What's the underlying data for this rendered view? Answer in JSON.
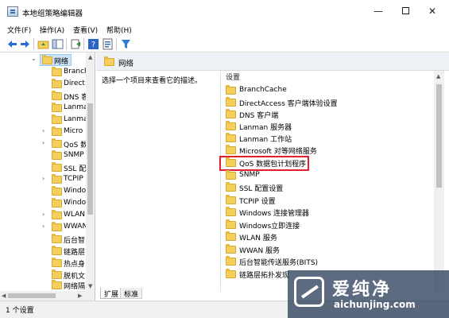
{
  "window": {
    "title": "本地组策略编辑器",
    "minimize": "—",
    "close": "✕"
  },
  "menu": [
    "文件(F)",
    "操作(A)",
    "查看(V)",
    "帮助(H)"
  ],
  "toolbar": {
    "icons": [
      "back-arrow-icon",
      "forward-arrow-icon",
      "folder-up-icon",
      "show-hide-tree-icon",
      "export-list-icon",
      "help-icon",
      "properties-icon",
      "filter-icon"
    ],
    "colors": {
      "arrow": "#2a6ad6",
      "help": "#2b63c6",
      "filter": "#2f7ad1"
    }
  },
  "tree": {
    "selected": "网络",
    "items": [
      {
        "label": "网络",
        "arrow": "⌄"
      },
      {
        "label": "Branch",
        "arrow": ""
      },
      {
        "label": "Direct",
        "arrow": ""
      },
      {
        "label": "DNS 客",
        "arrow": ""
      },
      {
        "label": "Lanma",
        "arrow": ""
      },
      {
        "label": "Lanma",
        "arrow": ""
      },
      {
        "label": "Micro",
        "arrow": "›"
      },
      {
        "label": "QoS 数",
        "arrow": "›"
      },
      {
        "label": "SNMP",
        "arrow": ""
      },
      {
        "label": "SSL 配",
        "arrow": ""
      },
      {
        "label": "TCPIP",
        "arrow": "›"
      },
      {
        "label": "Windo",
        "arrow": ""
      },
      {
        "label": "Windo",
        "arrow": ""
      },
      {
        "label": "WLAN",
        "arrow": "›"
      },
      {
        "label": "WWAN",
        "arrow": "›"
      },
      {
        "label": "后台智",
        "arrow": ""
      },
      {
        "label": "链路层",
        "arrow": ""
      },
      {
        "label": "热点身",
        "arrow": ""
      },
      {
        "label": "脱机文",
        "arrow": ""
      },
      {
        "label": "网络隔",
        "arrow": ""
      }
    ]
  },
  "main": {
    "header": "网络",
    "description": "选择一个项目来查看它的描述。",
    "column_header": "设置",
    "items": [
      "BranchCache",
      "DirectAccess 客户端体验设置",
      "DNS 客户端",
      "Lanman 服务器",
      "Lanman 工作站",
      "Microsoft 对等网络服务",
      "QoS 数据包计划程序",
      "SNMP",
      "SSL 配置设置",
      "TCPIP 设置",
      "Windows 连接管理器",
      "Windows立即连接",
      "WLAN 服务",
      "WWAN 服务",
      "后台智能传送服务(BITS)",
      "链路层拓扑发现"
    ],
    "highlighted_item": "QoS 数据包计划程序",
    "highlight_color": "#e0202a"
  },
  "tabs": [
    "扩展",
    "标准"
  ],
  "status": "1 个设置",
  "watermark": {
    "brand": "爱纯净",
    "url": "aichunjing.com"
  }
}
